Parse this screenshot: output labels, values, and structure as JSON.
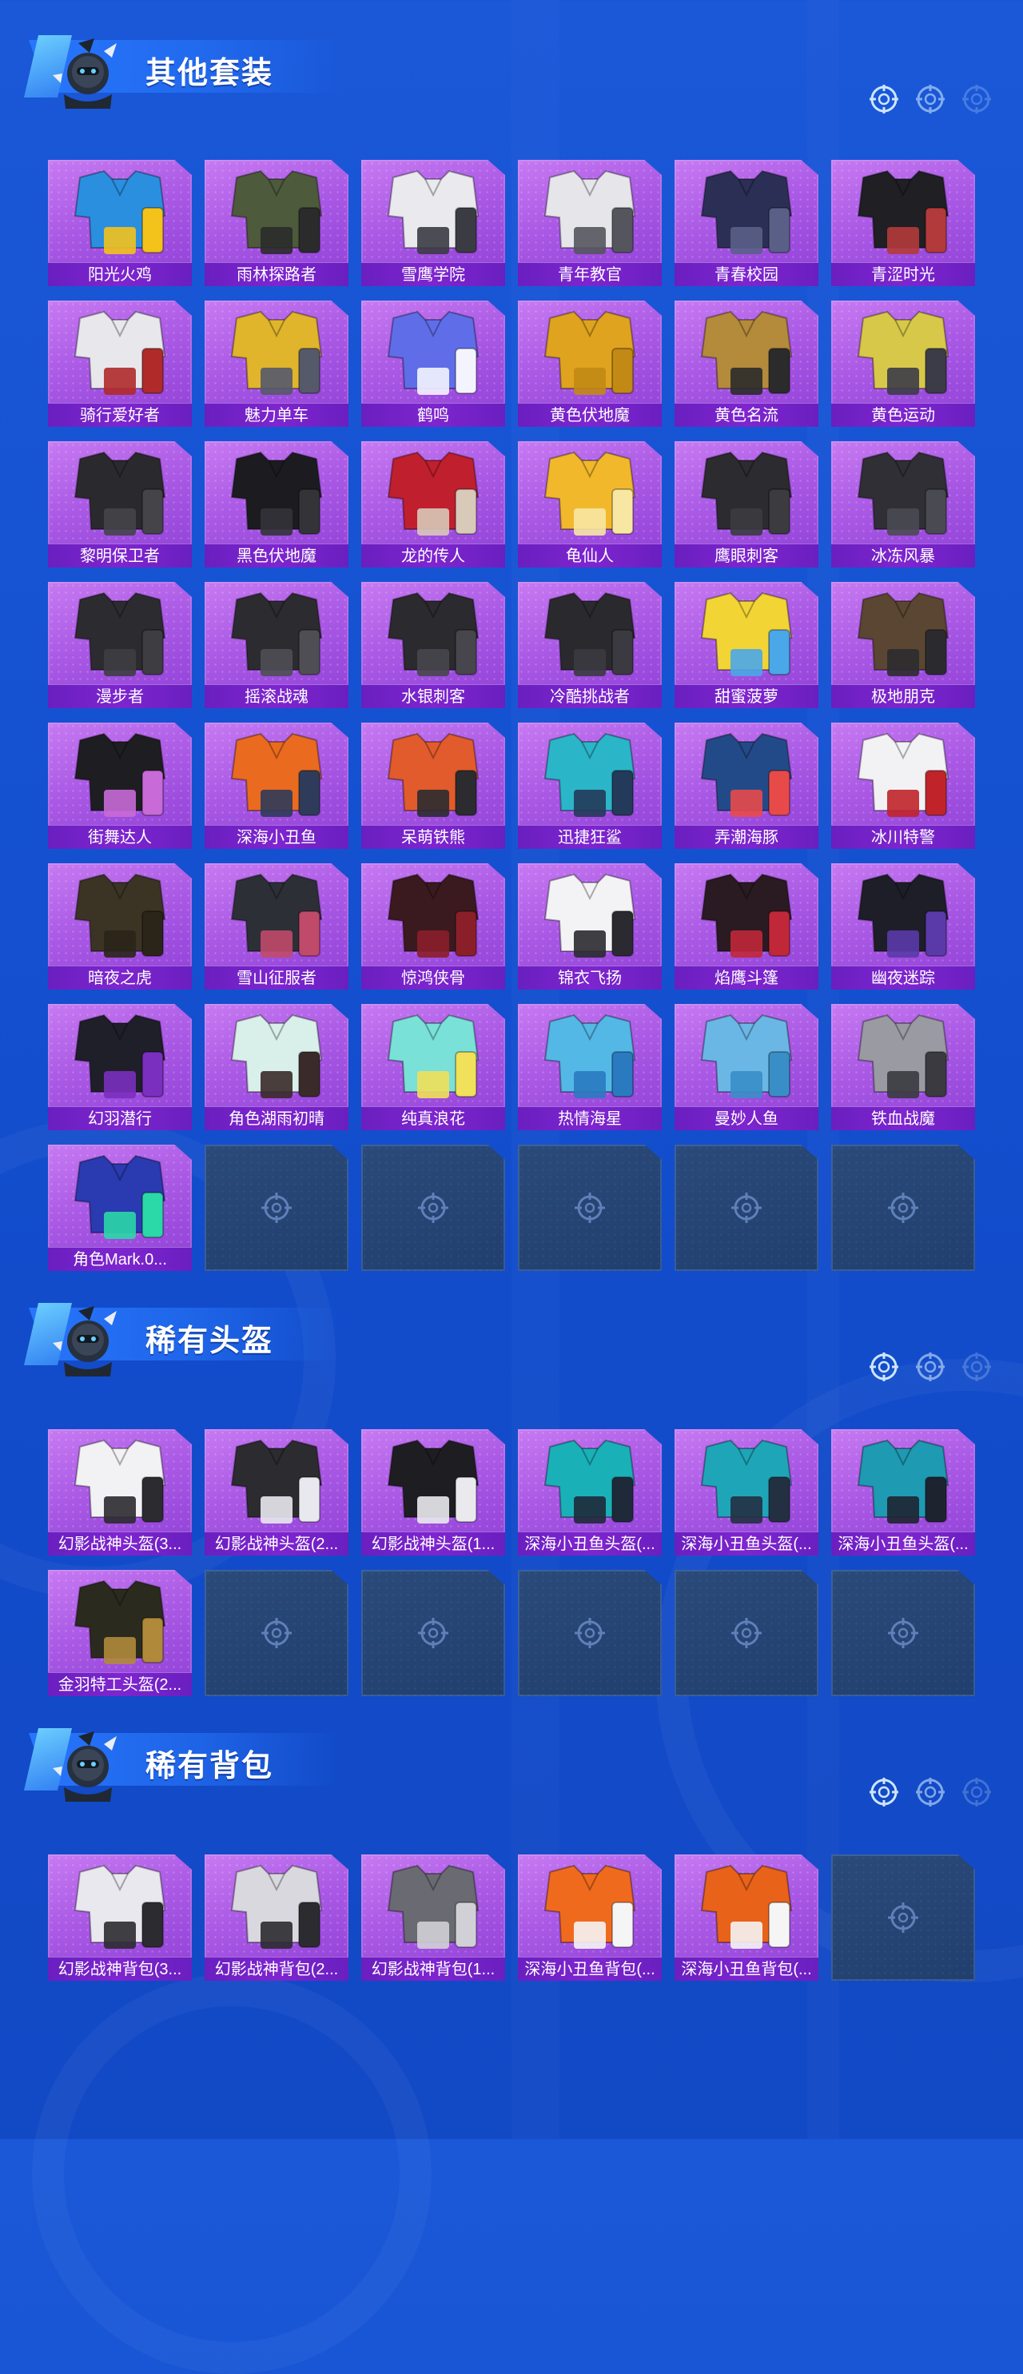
{
  "sections": [
    {
      "title": "其他套装",
      "items": [
        {
          "label": "阳光火鸡",
          "colors": [
            "#2b8fe0",
            "#f3c21b"
          ]
        },
        {
          "label": "雨林探路者",
          "colors": [
            "#4d5a3b",
            "#2b2b2b"
          ]
        },
        {
          "label": "雪鹰学院",
          "colors": [
            "#e9e9ee",
            "#3b3b44"
          ]
        },
        {
          "label": "青年教官",
          "colors": [
            "#e5e5ea",
            "#55555e"
          ]
        },
        {
          "label": "青春校园",
          "colors": [
            "#2c2f55",
            "#5a5f88"
          ]
        },
        {
          "label": "青涩时光",
          "colors": [
            "#1f1f24",
            "#b23a3a"
          ]
        },
        {
          "label": "骑行爱好者",
          "colors": [
            "#e7e7ec",
            "#b02a2a"
          ]
        },
        {
          "label": "魅力单车",
          "colors": [
            "#e0b52c",
            "#55596a"
          ]
        },
        {
          "label": "鹤鸣",
          "colors": [
            "#5f6ee8",
            "#f4f4ff"
          ]
        },
        {
          "label": "黄色伏地魔",
          "colors": [
            "#e0a31f",
            "#c28914"
          ]
        },
        {
          "label": "黄色名流",
          "colors": [
            "#b48a3b",
            "#2b2b2b"
          ]
        },
        {
          "label": "黄色运动",
          "colors": [
            "#d8c84a",
            "#3c3c48"
          ]
        },
        {
          "label": "黎明保卫者",
          "colors": [
            "#2a2a2e",
            "#444449"
          ]
        },
        {
          "label": "黑色伏地魔",
          "colors": [
            "#1c1c20",
            "#333338"
          ]
        },
        {
          "label": "龙的传人",
          "colors": [
            "#c01f2e",
            "#d8c9b8"
          ]
        },
        {
          "label": "龟仙人",
          "colors": [
            "#f2b82c",
            "#f7e7a3"
          ]
        },
        {
          "label": "鹰眼刺客",
          "colors": [
            "#2b2b30",
            "#3b3b40"
          ]
        },
        {
          "label": "冰冻风暴",
          "colors": [
            "#2f2f35",
            "#4a4a52"
          ]
        },
        {
          "label": "漫步者",
          "colors": [
            "#2c2c30",
            "#3d3d42"
          ]
        },
        {
          "label": "摇滚战魂",
          "colors": [
            "#2c2c30",
            "#4e4e54"
          ]
        },
        {
          "label": "水银刺客",
          "colors": [
            "#2a2a2f",
            "#46464c"
          ]
        },
        {
          "label": "冷酷挑战者",
          "colors": [
            "#2a2a2e",
            "#3a3a40"
          ]
        },
        {
          "label": "甜蜜菠萝",
          "colors": [
            "#f2d535",
            "#4aa7e8"
          ]
        },
        {
          "label": "极地朋克",
          "colors": [
            "#5a4632",
            "#2b2b2f"
          ]
        },
        {
          "label": "街舞达人",
          "colors": [
            "#1e1e22",
            "#c86ad8"
          ]
        },
        {
          "label": "深海小丑鱼",
          "colors": [
            "#ea6a1f",
            "#2f3b5a"
          ]
        },
        {
          "label": "呆萌铁熊",
          "colors": [
            "#e25b2c",
            "#2b2b30"
          ]
        },
        {
          "label": "迅捷狂鲨",
          "colors": [
            "#2bb5c8",
            "#233a5a"
          ]
        },
        {
          "label": "弄潮海豚",
          "colors": [
            "#234a88",
            "#e84a4a"
          ]
        },
        {
          "label": "冰川特警",
          "colors": [
            "#f2f2f5",
            "#c0242a"
          ]
        },
        {
          "label": "暗夜之虎",
          "colors": [
            "#3b3424",
            "#2a2518"
          ]
        },
        {
          "label": "雪山征服者",
          "colors": [
            "#2d2f36",
            "#c04a6a"
          ]
        },
        {
          "label": "惊鸿侠骨",
          "colors": [
            "#3a1a1f",
            "#8a1f2a"
          ]
        },
        {
          "label": "锦衣飞扬",
          "colors": [
            "#f3f3f6",
            "#2a2a30"
          ]
        },
        {
          "label": "焰鹰斗篷",
          "colors": [
            "#2a1a22",
            "#c0283a"
          ]
        },
        {
          "label": "幽夜迷踪",
          "colors": [
            "#1e1e28",
            "#5a3aa8"
          ]
        },
        {
          "label": "幻羽潜行",
          "colors": [
            "#1f1f2a",
            "#7a2fbf"
          ]
        },
        {
          "label": "角色湖雨初晴",
          "colors": [
            "#d9efe9",
            "#3a2a2a"
          ]
        },
        {
          "label": "纯真浪花",
          "colors": [
            "#7ae1d8",
            "#f0e05a"
          ]
        },
        {
          "label": "热情海星",
          "colors": [
            "#53b8e6",
            "#2a7ac0"
          ]
        },
        {
          "label": "曼妙人鱼",
          "colors": [
            "#6ab7e6",
            "#3a8ec8"
          ]
        },
        {
          "label": "铁血战魔",
          "colors": [
            "#9a9aa2",
            "#3a3a40"
          ]
        },
        {
          "label": "角色Mark.0...",
          "colors": [
            "#2a3ab0",
            "#2ad8a8"
          ]
        }
      ],
      "empty_slots": 5
    },
    {
      "title": "稀有头盔",
      "items": [
        {
          "label": "幻影战神头盔(3...",
          "colors": [
            "#f2f2f5",
            "#2b2b30"
          ]
        },
        {
          "label": "幻影战神头盔(2...",
          "colors": [
            "#2b2b30",
            "#e8e8ee"
          ]
        },
        {
          "label": "幻影战神头盔(1...",
          "colors": [
            "#1e1e22",
            "#e9e9ee"
          ]
        },
        {
          "label": "深海小丑鱼头盔(...",
          "colors": [
            "#1ab0b8",
            "#1e2a3a"
          ]
        },
        {
          "label": "深海小丑鱼头盔(...",
          "colors": [
            "#1ea6b8",
            "#233042"
          ]
        },
        {
          "label": "深海小丑鱼头盔(...",
          "colors": [
            "#1e9ab2",
            "#1e2330"
          ]
        },
        {
          "label": "金羽特工头盔(2...",
          "colors": [
            "#2b2a1e",
            "#b08a3a"
          ]
        }
      ],
      "empty_slots": 5
    },
    {
      "title": "稀有背包",
      "items": [
        {
          "label": "幻影战神背包(3...",
          "colors": [
            "#e8e8ee",
            "#2b2b30"
          ]
        },
        {
          "label": "幻影战神背包(2...",
          "colors": [
            "#d8d8de",
            "#2b2b30"
          ]
        },
        {
          "label": "幻影战神背包(1...",
          "colors": [
            "#6a6a72",
            "#d0d0d6"
          ]
        },
        {
          "label": "深海小丑鱼背包(...",
          "colors": [
            "#f06a1e",
            "#f5f5f5"
          ]
        },
        {
          "label": "深海小丑鱼背包(...",
          "colors": [
            "#e8621a",
            "#f5f5f5"
          ]
        }
      ],
      "empty_slots": 1
    }
  ]
}
